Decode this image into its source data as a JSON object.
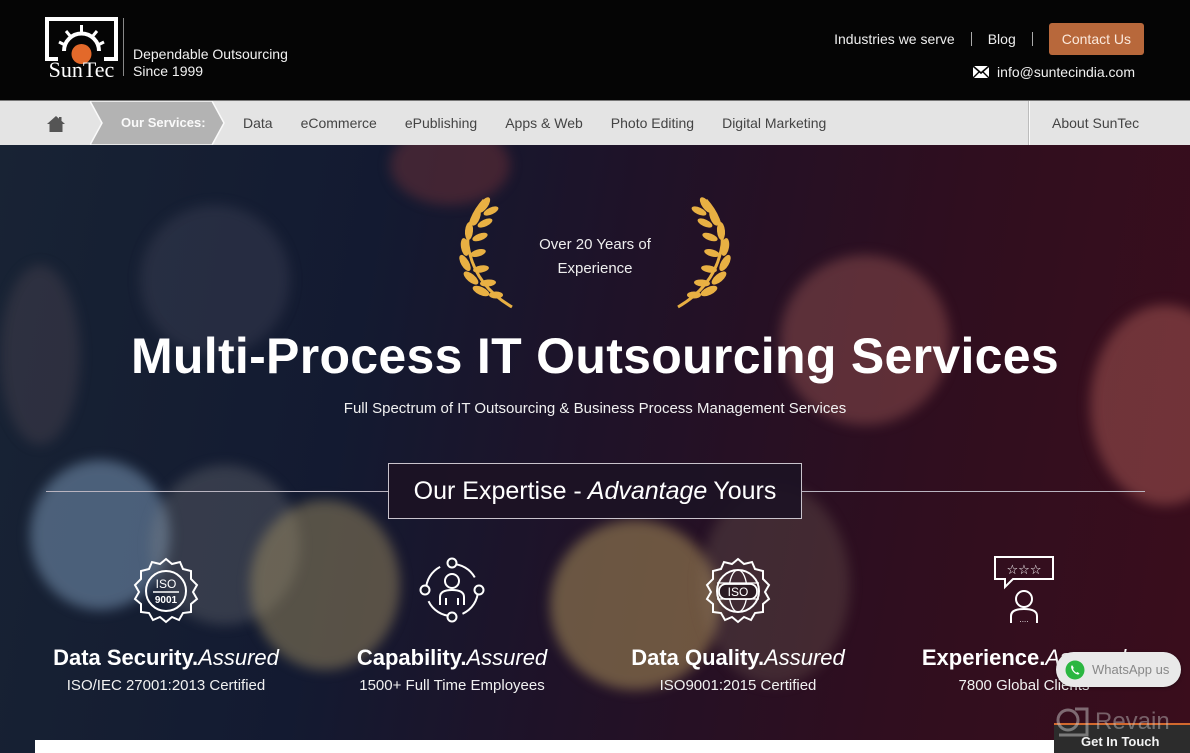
{
  "header": {
    "brand": "SunTec",
    "tagline_line1": "Dependable Outsourcing",
    "tagline_line2": "Since 1999",
    "links": {
      "industries": "Industries we serve",
      "blog": "Blog",
      "contact": "Contact Us"
    },
    "email": "info@suntecindia.com"
  },
  "nav": {
    "services_label": "Our Services:",
    "items": [
      "Data",
      "eCommerce",
      "ePublishing",
      "Apps & Web",
      "Photo Editing",
      "Digital Marketing"
    ],
    "about": "About SunTec"
  },
  "hero": {
    "badge_line1": "Over 20 Years of",
    "badge_line2": "Experience",
    "title": "Multi-Process IT Outsourcing Services",
    "subtitle": "Full Spectrum of IT Outsourcing & Business Process Management Services",
    "expertise": {
      "prefix": "Our Expertise -",
      "italic": "Advantage",
      "suffix": "Yours"
    },
    "features": [
      {
        "icon": "iso-9001-badge-icon",
        "title": "Data Security.",
        "title_italic": "Assured",
        "subtitle": "ISO/IEC 27001:2013 Certified"
      },
      {
        "icon": "people-network-icon",
        "title": "Capability.",
        "title_italic": "Assured",
        "subtitle": "1500+ Full Time Employees"
      },
      {
        "icon": "iso-globe-badge-icon",
        "title": "Data Quality.",
        "title_italic": "Assured",
        "subtitle": "ISO9001:2015 Certified"
      },
      {
        "icon": "customer-rating-icon",
        "title": "Experience.",
        "title_italic": "Assured",
        "subtitle": "7800 Global Clients"
      }
    ]
  },
  "widgets": {
    "whatsapp": "WhatsApp us",
    "get_in_touch": "Get In Touch",
    "watermark": "Revain"
  },
  "colors": {
    "accent": "#b8683b",
    "nav_bg": "#e4e4e4",
    "laurel_gold": "#e8b043"
  }
}
